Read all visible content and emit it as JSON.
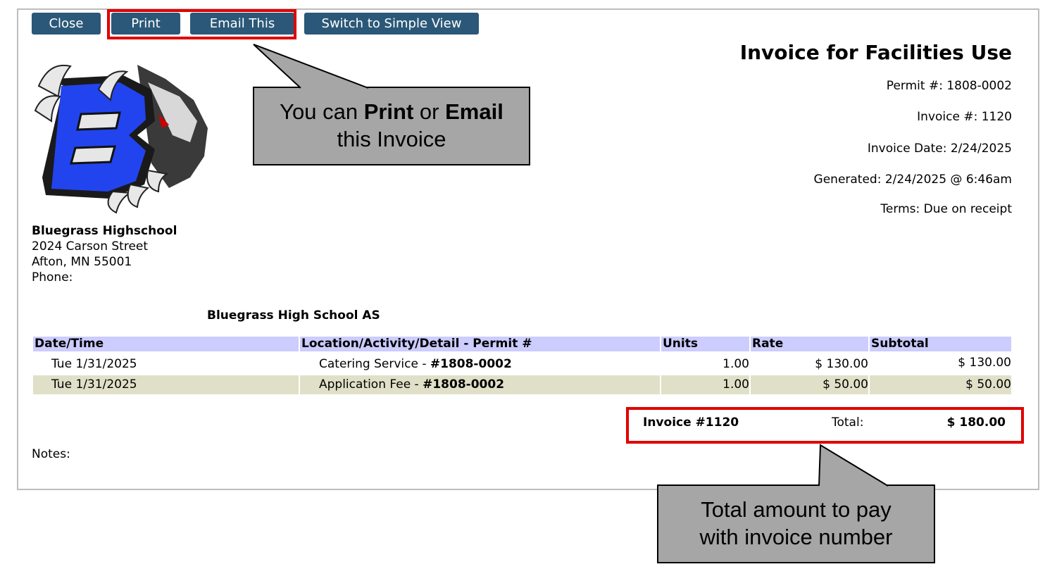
{
  "toolbar": {
    "close_label": "Close",
    "print_label": "Print",
    "email_label": "Email This",
    "simple_view_label": "Switch to Simple View"
  },
  "invoice": {
    "title": "Invoice for Facilities Use",
    "permit_label": "Permit #:",
    "permit_value": "1808-0002",
    "invoice_label": "Invoice #:",
    "invoice_value": "1120",
    "date_label": "Invoice Date:",
    "date_value": "2/24/2025",
    "generated_label": "Generated:",
    "generated_value": "2/24/2025 @ 6:46am",
    "terms_label": "Terms:",
    "terms_value": "Due on receipt"
  },
  "school": {
    "name": "Bluegrass Highschool",
    "street": "2024 Carson Street",
    "city": "Afton, MN 55001",
    "phone_label": "Phone:"
  },
  "customer": {
    "name": "Bluegrass High School AS"
  },
  "table": {
    "headers": [
      "Date/Time",
      "Location/Activity/Detail - Permit #",
      "Units",
      "Rate",
      "Subtotal"
    ],
    "rows": [
      {
        "date": "Tue 1/31/2025",
        "detail": "Catering Service - ",
        "permit": "#1808-0002",
        "units": "1.00",
        "rate": "$ 130.00",
        "subtotal": "$ 130.00"
      },
      {
        "date": "Tue 1/31/2025",
        "detail": "Application Fee - ",
        "permit": "#1808-0002",
        "units": "1.00",
        "rate": "$ 50.00",
        "subtotal": "$ 50.00"
      }
    ]
  },
  "total": {
    "invoice_label": "Invoice #1120",
    "total_label": "Total:",
    "total_value": "$ 180.00"
  },
  "notes_label": "Notes:",
  "callouts": {
    "print_email": {
      "pre": "You can ",
      "b1": "Print",
      "mid": " or ",
      "b2": "Email",
      "post": "this Invoice"
    },
    "total": {
      "line1": "Total amount to pay",
      "line2": "with invoice number"
    }
  },
  "colors": {
    "button": "#2b5878",
    "header_row": "#ccccff",
    "alt_row": "#e0e0c8",
    "highlight": "#e00000",
    "callout": "#a6a6a6"
  }
}
